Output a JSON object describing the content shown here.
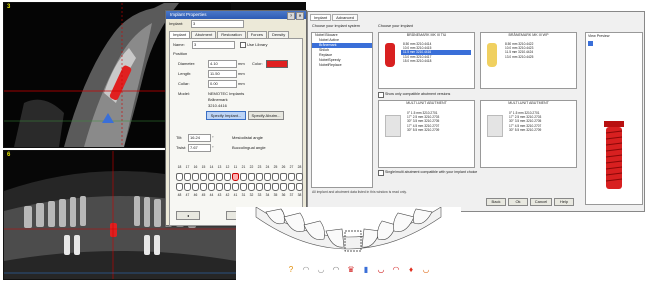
{
  "scans": {
    "top_left": {
      "corner_label": "3"
    },
    "bottom_left": {
      "corner_label": "6"
    }
  },
  "dialog": {
    "title": "Implant Properties",
    "tabs": [
      "Implant",
      "Abutment",
      "Restoration",
      "Forces",
      "Density"
    ],
    "implant_label": "Implant:",
    "implant_value": "3",
    "name_label": "Name:",
    "name_value": "3",
    "use_library_label": "Use Library",
    "position_label": "Position",
    "diameter_label": "Diameter:",
    "diameter_value": "4.10",
    "length_label": "Length:",
    "length_value": "11.50",
    "unit": "mm",
    "color_label": "Color:",
    "collar_label": "Collar:",
    "collar_value": "0.00",
    "model_label": "Model:",
    "model_lines": [
      "NEMOTEC Implants",
      "Brånemark",
      "3210.4416"
    ],
    "specify_implant": "Specify Implant...",
    "specify_abutment": "Specify Abutm...",
    "tilt_label": "Tilt:",
    "tilt_value": "16.24",
    "twist_label": "Twist:",
    "twist_value": "7.67",
    "mesiodistal_label": "Mesiodistal angle",
    "buccolingual_label": "Buccolingual angle",
    "tooth_numbers_upper": [
      "18",
      "17",
      "16",
      "15",
      "14",
      "13",
      "12",
      "11",
      "21",
      "22",
      "23",
      "24",
      "25",
      "26",
      "27",
      "28"
    ],
    "tooth_numbers_lower": [
      "48",
      "47",
      "46",
      "45",
      "44",
      "43",
      "42",
      "41",
      "31",
      "32",
      "33",
      "34",
      "35",
      "36",
      "37",
      "38"
    ],
    "selected_tooth_index": 7,
    "ok": "Ok",
    "cancel": "Cancel",
    "accent_color": "#e02020"
  },
  "app": {
    "tabs": [
      "Implant",
      "Advanced"
    ],
    "section_left": "Choose your implant system",
    "section_right": "Choose your implant",
    "tree": [
      "Nobel Biocare",
      "Nobel Active",
      "Brånemark",
      "Shiloh",
      "Replace",
      "NobelSpeedy",
      "NobelReplace"
    ],
    "tree_selected": 2,
    "top_boxes": [
      {
        "header": "BRÅNEMARK MK III TiU",
        "rows": [
          "8.50 mm 3210.4414",
          "10.0 mm 3210.4415",
          "11.5 mm 3210.4416",
          "13.0 mm 3210.4417",
          "15.0 mm 3210.4418"
        ],
        "selected": 2
      },
      {
        "header": "BRÅNEMARK MK III WP",
        "rows": [
          "8.50 mm 3210.4422",
          "10.0 mm 3210.4423",
          "11.5 mm 3210.4424",
          "13.0 mm 3210.4425"
        ],
        "selected": -1
      }
    ],
    "checkbox_compatible": "Show only compatible abutment versions",
    "abut_header_left": "MULTI-UNIT ABUTMENT",
    "abut_header_right": "MULTI-UNIT ABUTMENT",
    "abut_rows": [
      "0°   1.5 mm  3210.2701",
      "17°  2.5 mm  3210.2703",
      "30°  3.5 mm  3210.2705",
      "17°  4.5 mm  3210.2707",
      "30°  5.5 mm  3210.2709"
    ],
    "checkbox_bottom": "Single/multi abutment compatible with your implant choice",
    "footnote": "All implant and abutment data listed in this window is read only.",
    "buttons": [
      "Back",
      "Ok",
      "Cancel",
      "Help"
    ],
    "preview_label": "View Preview",
    "implant_color": "#d82020",
    "implant_gold": "#f0d060"
  },
  "toolbar": {
    "icons": [
      "question-icon",
      "tooth-outline-icon",
      "lower-jaw-icon",
      "upper-jaw-icon",
      "crown-icon",
      "implant-icon",
      "jaw-red-icon",
      "jaw-red-2-icon",
      "tooth-red-icon",
      "jaw-orange-icon"
    ]
  }
}
